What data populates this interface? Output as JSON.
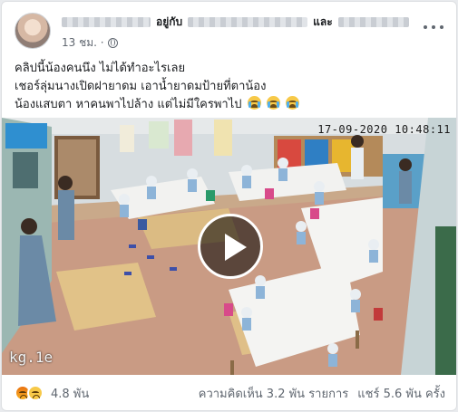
{
  "post": {
    "author_suffix": "อยู่กับ",
    "connector": "และ",
    "time": "13 ชม. ·",
    "caption_lines": [
      "คลิปนี้น้องคนนึง ไม่ได้ทำอะไรเลย",
      "เชอร์ลุ่มนางเปิดฝายาดม เอาน้ำยาดมป้ายที่ตาน้อง",
      "น้องแสบตา หาคนพาไปล้าง แต่ไม่มีใครพาไป"
    ],
    "caption_emoji_count": 3,
    "privacy_icon": "globe-icon",
    "menu_icon": "more-horizontal-icon"
  },
  "video": {
    "timestamp": "17-09-2020 10:48:11",
    "watermark": "kg.1e",
    "play_icon": "play-icon"
  },
  "footer": {
    "reaction_icons": [
      "angry-reaction-icon",
      "sad-reaction-icon"
    ],
    "reaction_count": "4.8 พัน",
    "comments": "ความคิดเห็น 3.2 พัน รายการ",
    "shares": "แชร์ 5.6 พัน ครั้ง"
  },
  "colors": {
    "text": "#1c1e21",
    "secondary_text": "#606770",
    "border": "#dddfe2"
  }
}
